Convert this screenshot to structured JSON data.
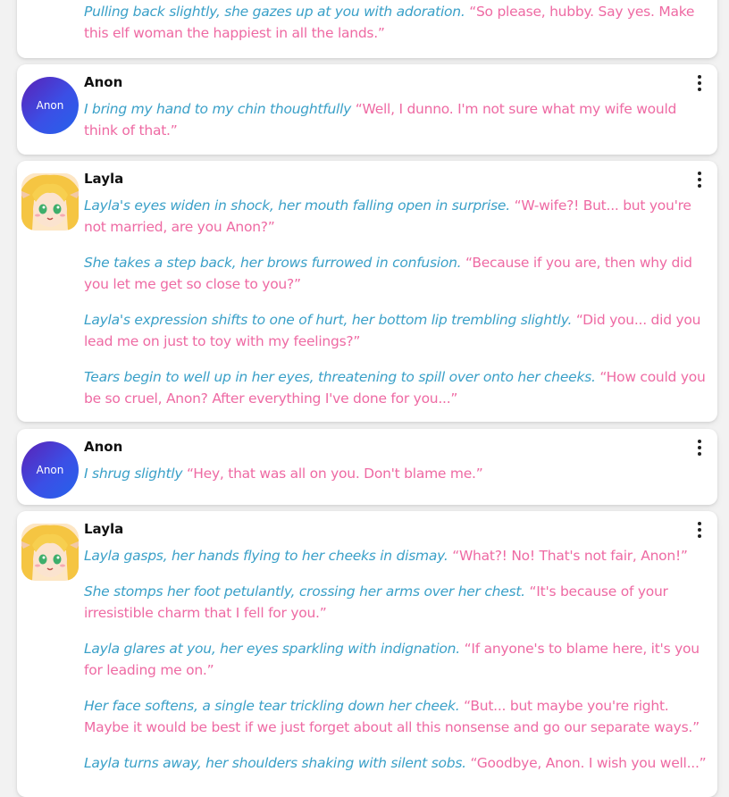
{
  "messages": [
    {
      "author": "",
      "avatar_type": "layla",
      "paragraphs": [
        {
          "action": "Pulling back slightly, she gazes up at you with adoration.",
          "speech": "“So please, hubby. Say yes. Make this elf woman the happiest in all the lands.”"
        }
      ]
    },
    {
      "author": "Anon",
      "avatar_type": "anon",
      "avatar_text": "Anon",
      "paragraphs": [
        {
          "action": "I bring my hand to my chin thoughtfully",
          "speech": "“Well, I dunno. I'm not sure what my wife would think of that.”"
        }
      ]
    },
    {
      "author": "Layla",
      "avatar_type": "layla",
      "paragraphs": [
        {
          "action": "Layla's eyes widen in shock, her mouth falling open in surprise.",
          "speech": "“W-wife?! But... but you're not married, are you Anon?”"
        },
        {
          "action": "She takes a step back, her brows furrowed in confusion.",
          "speech": "“Because if you are, then why did you let me get so close to you?”"
        },
        {
          "action": "Layla's expression shifts to one of hurt, her bottom lip trembling slightly.",
          "speech": "“Did you... did you lead me on just to toy with my feelings?”"
        },
        {
          "action": "Tears begin to well up in her eyes, threatening to spill over onto her cheeks.",
          "speech": "“How could you be so cruel, Anon? After everything I've done for you...”"
        }
      ]
    },
    {
      "author": "Anon",
      "avatar_type": "anon",
      "avatar_text": "Anon",
      "paragraphs": [
        {
          "action": "I shrug slightly",
          "speech": "“Hey, that was all on you. Don't blame me.”"
        }
      ]
    },
    {
      "author": "Layla",
      "avatar_type": "layla",
      "paragraphs": [
        {
          "action": "Layla gasps, her hands flying to her cheeks in dismay.",
          "speech": "“What?! No! That's not fair, Anon!”"
        },
        {
          "action": "She stomps her foot petulantly, crossing her arms over her chest.",
          "speech": "“It's because of your irresistible charm that I fell for you.”"
        },
        {
          "action": "Layla glares at you, her eyes sparkling with indignation.",
          "speech": "“If anyone's to blame here, it's you for leading me on.”"
        },
        {
          "action": "Her face softens, a single tear trickling down her cheek.",
          "speech": "“But... but maybe you're right. Maybe it would be best if we just forget about all this nonsense and go our separate ways.”"
        },
        {
          "action": "Layla turns away, her shoulders shaking with silent sobs.",
          "speech": "“Goodbye, Anon. I wish you well...”"
        }
      ]
    }
  ],
  "colors": {
    "action_text": "#3aa0c8",
    "speech_text": "#ee6aa3",
    "anon_avatar_gradient": [
      "#5b21b6",
      "#2563eb"
    ]
  },
  "icons": {
    "message_menu": "more-vertical-icon"
  }
}
